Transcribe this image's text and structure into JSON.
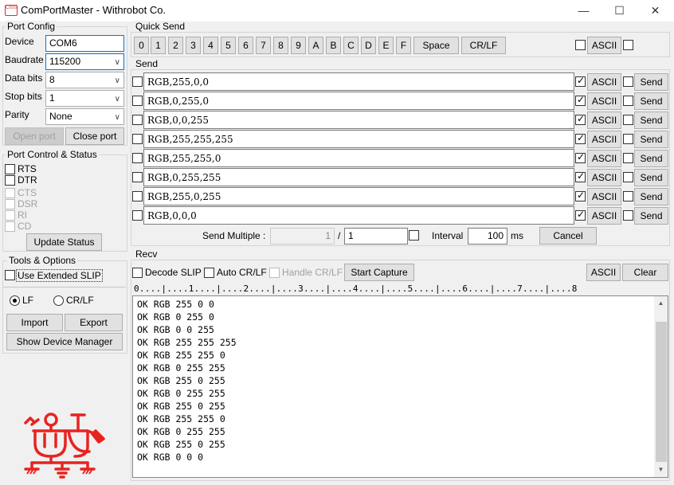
{
  "window": {
    "title": "ComPortMaster - Withrobot Co.",
    "icon_text": "CISS",
    "minimize": "—",
    "maximize": "☐",
    "close": "✕"
  },
  "port_config": {
    "group_label": "Port Config",
    "device_label": "Device",
    "device_value": "COM6",
    "baudrate_label": "Baudrate",
    "baudrate_value": "115200",
    "databits_label": "Data bits",
    "databits_value": "8",
    "stopbits_label": "Stop bits",
    "stopbits_value": "1",
    "parity_label": "Parity",
    "parity_value": "None",
    "open_port": "Open port",
    "close_port": "Close port"
  },
  "port_control": {
    "group_label": "Port Control & Status",
    "rts": "RTS",
    "dtr": "DTR",
    "cts": "CTS",
    "dsr": "DSR",
    "ri": "RI",
    "cd": "CD",
    "update_status": "Update Status"
  },
  "tools": {
    "group_label": "Tools & Options",
    "use_slip": "Use Extended SLIP",
    "lf": "LF",
    "crlf": "CR/LF",
    "import": "Import",
    "export": "Export",
    "show_device_manager": "Show Device Manager"
  },
  "quick_send": {
    "group_label": "Quick Send",
    "keys": [
      "0",
      "1",
      "2",
      "3",
      "4",
      "5",
      "6",
      "7",
      "8",
      "9",
      "A",
      "B",
      "C",
      "D",
      "E",
      "F"
    ],
    "space": "Space",
    "crlf": "CR/LF",
    "ascii": "ASCII"
  },
  "send": {
    "group_label": "Send",
    "ascii_label": "ASCII",
    "send_label": "Send",
    "rows": [
      {
        "value": "RGB,255,0,0"
      },
      {
        "value": "RGB,0,255,0"
      },
      {
        "value": "RGB,0,0,255"
      },
      {
        "value": "RGB,255,255,255"
      },
      {
        "value": "RGB,255,255,0"
      },
      {
        "value": "RGB,0,255,255"
      },
      {
        "value": "RGB,255,0,255"
      },
      {
        "value": "RGB,0,0,0"
      }
    ],
    "send_multiple_label": "Send Multiple :",
    "multiple_count": "1",
    "slash": "/",
    "multiple_total": "1",
    "interval_label": "Interval",
    "interval_value": "100",
    "interval_unit": "ms",
    "cancel": "Cancel"
  },
  "recv": {
    "group_label": "Recv",
    "decode_slip": "Decode SLIP",
    "auto_crlf": "Auto CR/LF",
    "handle_crlf": "Handle CR/LF",
    "start_capture": "Start Capture",
    "ascii": "ASCII",
    "clear": "Clear",
    "ruler": "0....|....1....|....2....|....3....|....4....|....5....|....6....|....7....|....8",
    "lines": [
      "OK RGB 255 0 0",
      "OK RGB 0 255 0",
      "OK RGB 0 0 255",
      "OK RGB 255 255 255",
      "OK RGB 255 255 0",
      "OK RGB 0 255 255",
      "OK RGB 255 0 255",
      "OK RGB 0 255 255",
      "OK RGB 255 0 255",
      "OK RGB 255 255 0",
      "OK RGB 0 255 255",
      "OK RGB 255 0 255",
      "OK RGB 0 0 0"
    ],
    "scroll_up": "▲",
    "scroll_down": "▼"
  },
  "colors": {
    "accent": "#0078d7",
    "logo": "#e8231f"
  }
}
